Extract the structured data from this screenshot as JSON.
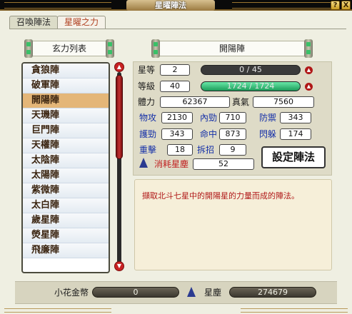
{
  "window": {
    "title": "星曜陣法",
    "help_label": "?",
    "close_label": "X"
  },
  "tabs": [
    {
      "label": "召喚陣法"
    },
    {
      "label": "星曜之力"
    }
  ],
  "list_header": "玄力列表",
  "formation_title": "開陽陣",
  "formations": [
    "貪狼陣",
    "破軍陣",
    "開陽陣",
    "天璣陣",
    "巨門陣",
    "天權陣",
    "太陰陣",
    "太陽陣",
    "紫微陣",
    "太白陣",
    "歲星陣",
    "熒星陣",
    "飛廉陣"
  ],
  "selected_index": 2,
  "stats": {
    "star_label": "星等",
    "star_value": "2",
    "star_exp": "0 / 45",
    "star_exp_fraction": 0,
    "level_label": "等級",
    "level_value": "40",
    "level_exp": "1724 / 1724",
    "level_exp_fraction": 1,
    "hp_label": "體力",
    "hp_value": "62367",
    "mp_label": "真氣",
    "mp_value": "7560",
    "patk_label": "物攻",
    "patk_value": "2130",
    "inner_label": "內勁",
    "inner_value": "710",
    "def_label": "防禦",
    "def_value": "343",
    "guard_label": "護勁",
    "guard_value": "343",
    "hit_label": "命中",
    "hit_value": "873",
    "dodge_label": "閃躲",
    "dodge_value": "174",
    "heavy_label": "重擊",
    "heavy_value": "18",
    "parry_label": "拆招",
    "parry_value": "9",
    "cost_label": "消耗星塵",
    "cost_value": "52"
  },
  "set_button": "設定陣法",
  "description": "擷取北斗七星中的開陽星的力量而成的陣法。",
  "bottom": {
    "coin_label": "小花金幣",
    "coin_value": "0",
    "dust_label": "星塵",
    "dust_value": "274679"
  }
}
